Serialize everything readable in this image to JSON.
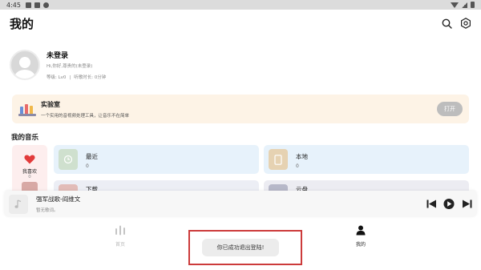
{
  "status_bar": {
    "time": "4:45"
  },
  "header": {
    "title": "我的"
  },
  "profile": {
    "name": "未登录",
    "greeting": "Hi,你好,尊贵的(未登录)",
    "level": "等级: Lv0",
    "separator": "|",
    "listen_time": "听歌时长: 0分钟"
  },
  "lab": {
    "title": "实验室",
    "subtitle": "一个实用的音视频处理工具，让音乐不在简单",
    "button": "打开"
  },
  "my_music": {
    "title": "我的音乐",
    "favorite": {
      "label": "我喜欢",
      "count": "0"
    },
    "tiles": [
      {
        "label": "最近",
        "count": "0"
      },
      {
        "label": "本地",
        "count": "0"
      },
      {
        "label": "下载",
        "count": ""
      },
      {
        "label": "云盘",
        "count": ""
      }
    ]
  },
  "player": {
    "title": "强军战歌-阎维文",
    "lyric": "暂无歌词。"
  },
  "bottom_nav": {
    "home": "首页",
    "mine": "我的"
  },
  "toast": {
    "message": "你已成功退出登陆!"
  },
  "colors": {
    "lab_bg": "#fdf3e6",
    "favorite_bg": "#fdeeee",
    "heart": "#e23b3b",
    "tile_recent": "#e7f2fb",
    "highlight_border": "#cc3b3b"
  }
}
